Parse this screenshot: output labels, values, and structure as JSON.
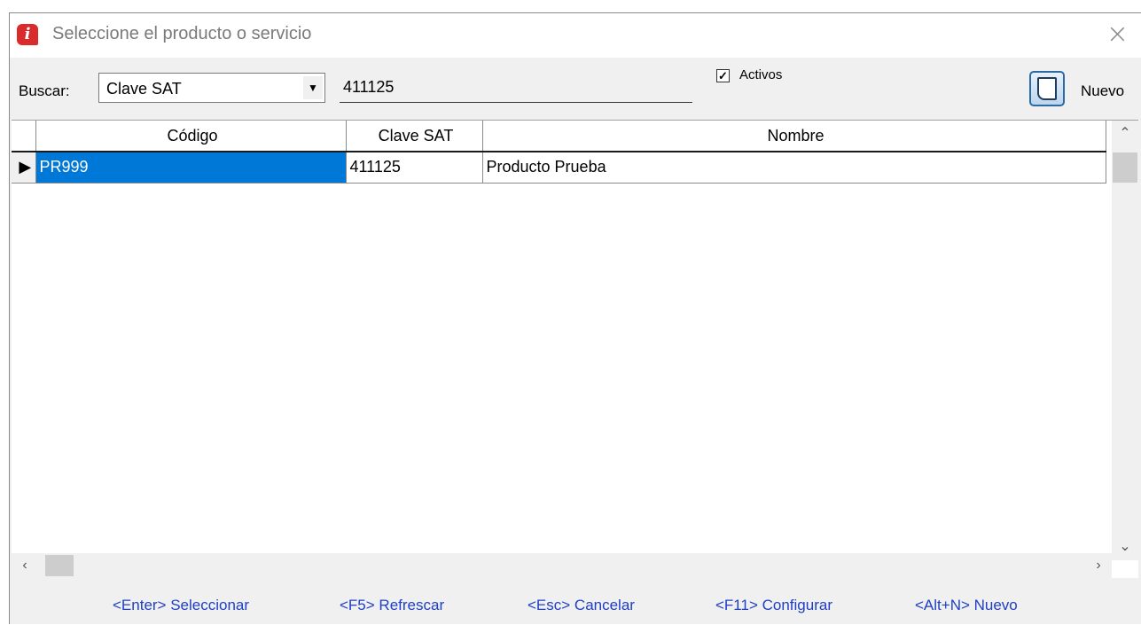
{
  "window": {
    "title": "Seleccione el producto o servicio",
    "icon": "info-app-icon",
    "close_glyph": "×"
  },
  "toolbar": {
    "buscar_label": "Buscar:",
    "search_by": "Clave SAT",
    "search_value": "411125",
    "activos_label": "Activos",
    "activos_checked": true,
    "nuevo_label": "Nuevo"
  },
  "table": {
    "columns": [
      "Código",
      "Clave SAT",
      "Nombre"
    ],
    "rows": [
      {
        "codigo": "PR999",
        "clave_sat": "411125",
        "nombre": "Producto Prueba"
      }
    ]
  },
  "footer": {
    "hints": [
      "<Enter> Seleccionar",
      "<F5> Refrescar",
      "<Esc> Cancelar",
      "<F11> Configurar",
      "<Alt+N> Nuevo"
    ]
  },
  "colors": {
    "selection": "#0078d7",
    "header_selected": "#bcd4ef",
    "hint_text": "#1f3fc4",
    "app_icon": "#d92b2b"
  }
}
